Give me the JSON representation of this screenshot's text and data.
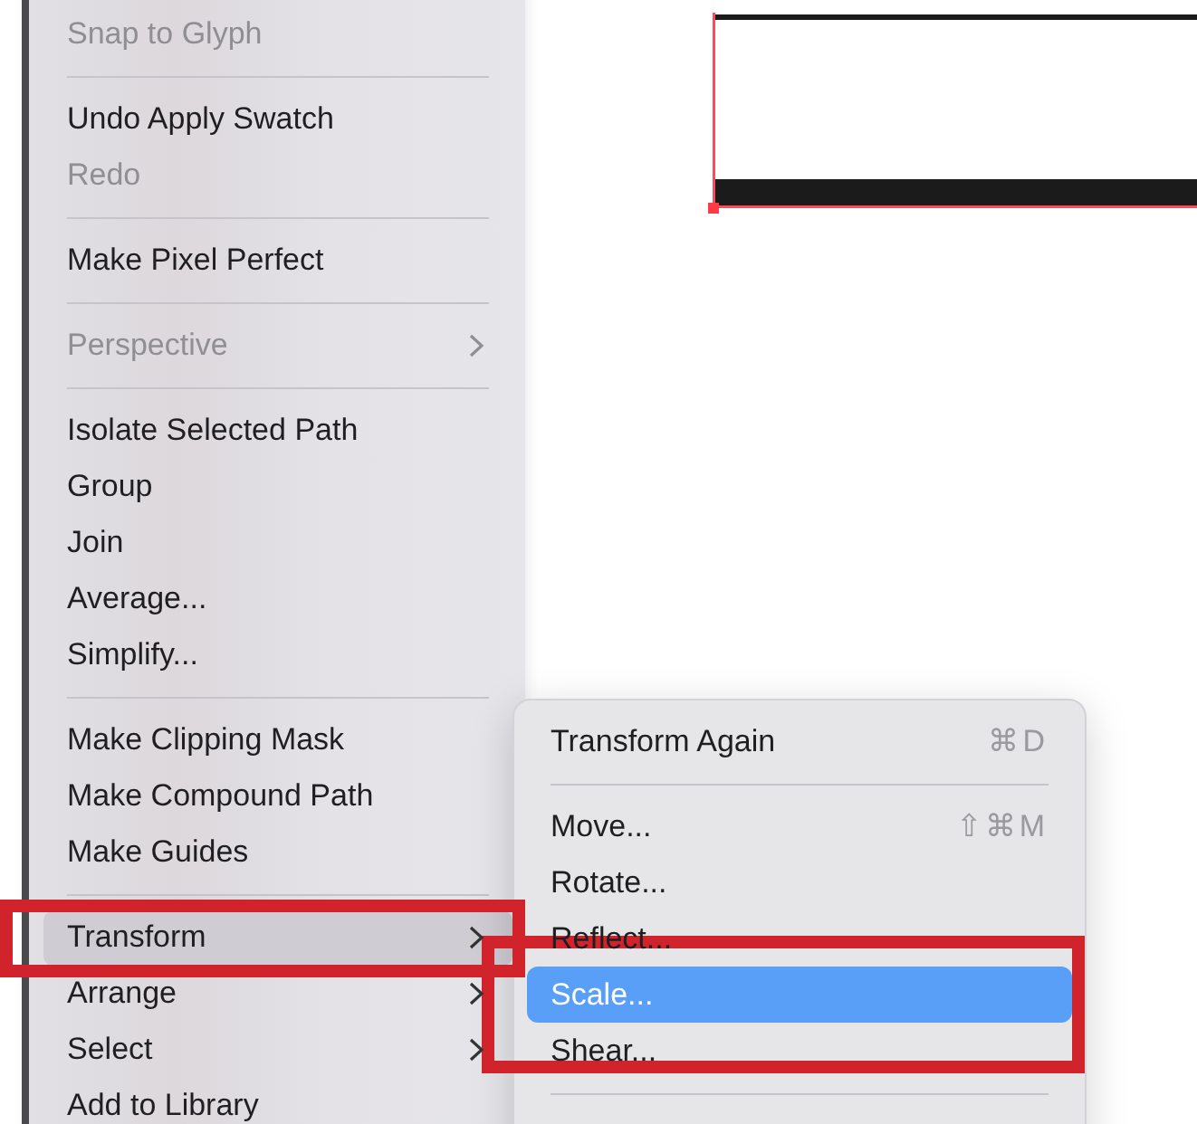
{
  "canvas": {
    "shapes": [
      {
        "kind": "rectangle",
        "selected": true
      }
    ]
  },
  "menu": {
    "highlight_box": true,
    "items": [
      {
        "kind": "item",
        "label": "Snap to Glyph",
        "disabled": true,
        "selected": false,
        "submenu": false
      },
      {
        "kind": "separator"
      },
      {
        "kind": "item",
        "label": "Undo Apply Swatch",
        "disabled": false,
        "selected": false,
        "submenu": false
      },
      {
        "kind": "item",
        "label": "Redo",
        "disabled": true,
        "selected": false,
        "submenu": false
      },
      {
        "kind": "separator"
      },
      {
        "kind": "item",
        "label": "Make Pixel Perfect",
        "disabled": false,
        "selected": false,
        "submenu": false
      },
      {
        "kind": "separator"
      },
      {
        "kind": "item",
        "label": "Perspective",
        "disabled": true,
        "selected": false,
        "submenu": true
      },
      {
        "kind": "separator"
      },
      {
        "kind": "item",
        "label": "Isolate Selected Path",
        "disabled": false,
        "selected": false,
        "submenu": false
      },
      {
        "kind": "item",
        "label": "Group",
        "disabled": false,
        "selected": false,
        "submenu": false
      },
      {
        "kind": "item",
        "label": "Join",
        "disabled": false,
        "selected": false,
        "submenu": false
      },
      {
        "kind": "item",
        "label": "Average...",
        "disabled": false,
        "selected": false,
        "submenu": false
      },
      {
        "kind": "item",
        "label": "Simplify...",
        "disabled": false,
        "selected": false,
        "submenu": false
      },
      {
        "kind": "separator"
      },
      {
        "kind": "item",
        "label": "Make Clipping Mask",
        "disabled": false,
        "selected": false,
        "submenu": false
      },
      {
        "kind": "item",
        "label": "Make Compound Path",
        "disabled": false,
        "selected": false,
        "submenu": false
      },
      {
        "kind": "item",
        "label": "Make Guides",
        "disabled": false,
        "selected": false,
        "submenu": false
      },
      {
        "kind": "separator"
      },
      {
        "kind": "item",
        "label": "Transform",
        "disabled": false,
        "selected": true,
        "submenu": true
      },
      {
        "kind": "item",
        "label": "Arrange",
        "disabled": false,
        "selected": false,
        "submenu": true
      },
      {
        "kind": "item",
        "label": "Select",
        "disabled": false,
        "selected": false,
        "submenu": true
      },
      {
        "kind": "item",
        "label": "Add to Library",
        "disabled": false,
        "selected": false,
        "submenu": false
      }
    ]
  },
  "submenu": {
    "highlight_box": true,
    "items": [
      {
        "kind": "item",
        "label": "Transform Again",
        "shortcut": "⌘D",
        "disabled": false,
        "selected": false
      },
      {
        "kind": "separator"
      },
      {
        "kind": "item",
        "label": "Move...",
        "shortcut": "⇧⌘M",
        "disabled": false,
        "selected": false
      },
      {
        "kind": "item",
        "label": "Rotate...",
        "disabled": false,
        "selected": false
      },
      {
        "kind": "item",
        "label": "Reflect...",
        "disabled": false,
        "selected": false
      },
      {
        "kind": "item",
        "label": "Scale...",
        "disabled": false,
        "selected": true
      },
      {
        "kind": "item",
        "label": "Shear...",
        "disabled": false,
        "selected": false
      },
      {
        "kind": "separator"
      }
    ]
  }
}
